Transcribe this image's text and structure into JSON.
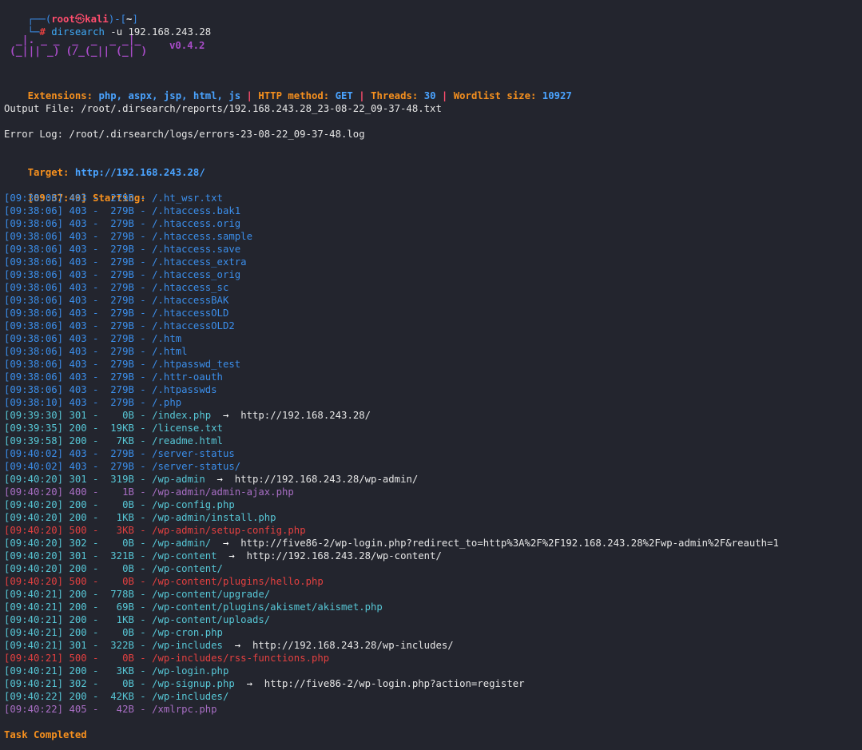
{
  "prompt": {
    "corner_top": "┌──(",
    "user": "root",
    "skull": "㉿",
    "host": "kali",
    "close": ")-[",
    "dir": "~",
    "close2": "]",
    "corner_bottom": "└─",
    "hash": "#",
    "command": "dirsearch",
    "args": " -u 192.168.243.28"
  },
  "banner": {
    "art_line1": " _|. _ _  _  _  _ _|_",
    "art_line2": "(_||| _) (/_(_|| (_| )",
    "version": "v0.4.2"
  },
  "config": {
    "ext_label": "Extensions: ",
    "ext_value": "php, aspx, jsp, html, js",
    "sep": " | ",
    "method_label": "HTTP method: ",
    "method_value": "GET",
    "threads_label": "Threads: ",
    "threads_value": "30",
    "wordlist_label": "Wordlist size: ",
    "wordlist_value": "10927"
  },
  "output_file": "Output File: /root/.dirsearch/reports/192.168.243.28_23-08-22_09-37-48.txt",
  "error_log": "Error Log: /root/.dirsearch/logs/errors-23-08-22_09-37-48.log",
  "target_label": "Target: ",
  "target_url": "http://192.168.243.28/",
  "start_time": "[09:37:49]",
  "start_label": " Starting:",
  "results": [
    {
      "t": "[09:38:06]",
      "code": "403",
      "size": "279B",
      "path": "/.ht_wsr.txt",
      "redirect": ""
    },
    {
      "t": "[09:38:06]",
      "code": "403",
      "size": "279B",
      "path": "/.htaccess.bak1",
      "redirect": ""
    },
    {
      "t": "[09:38:06]",
      "code": "403",
      "size": "279B",
      "path": "/.htaccess.orig",
      "redirect": ""
    },
    {
      "t": "[09:38:06]",
      "code": "403",
      "size": "279B",
      "path": "/.htaccess.sample",
      "redirect": ""
    },
    {
      "t": "[09:38:06]",
      "code": "403",
      "size": "279B",
      "path": "/.htaccess.save",
      "redirect": ""
    },
    {
      "t": "[09:38:06]",
      "code": "403",
      "size": "279B",
      "path": "/.htaccess_extra",
      "redirect": ""
    },
    {
      "t": "[09:38:06]",
      "code": "403",
      "size": "279B",
      "path": "/.htaccess_orig",
      "redirect": ""
    },
    {
      "t": "[09:38:06]",
      "code": "403",
      "size": "279B",
      "path": "/.htaccess_sc",
      "redirect": ""
    },
    {
      "t": "[09:38:06]",
      "code": "403",
      "size": "279B",
      "path": "/.htaccessBAK",
      "redirect": ""
    },
    {
      "t": "[09:38:06]",
      "code": "403",
      "size": "279B",
      "path": "/.htaccessOLD",
      "redirect": ""
    },
    {
      "t": "[09:38:06]",
      "code": "403",
      "size": "279B",
      "path": "/.htaccessOLD2",
      "redirect": ""
    },
    {
      "t": "[09:38:06]",
      "code": "403",
      "size": "279B",
      "path": "/.htm",
      "redirect": ""
    },
    {
      "t": "[09:38:06]",
      "code": "403",
      "size": "279B",
      "path": "/.html",
      "redirect": ""
    },
    {
      "t": "[09:38:06]",
      "code": "403",
      "size": "279B",
      "path": "/.htpasswd_test",
      "redirect": ""
    },
    {
      "t": "[09:38:06]",
      "code": "403",
      "size": "279B",
      "path": "/.httr-oauth",
      "redirect": ""
    },
    {
      "t": "[09:38:06]",
      "code": "403",
      "size": "279B",
      "path": "/.htpasswds",
      "redirect": ""
    },
    {
      "t": "[09:38:10]",
      "code": "403",
      "size": "279B",
      "path": "/.php",
      "redirect": ""
    },
    {
      "t": "[09:39:30]",
      "code": "301",
      "size": "0B",
      "path": "/index.php",
      "redirect": "http://192.168.243.28/"
    },
    {
      "t": "[09:39:35]",
      "code": "200",
      "size": "19KB",
      "path": "/license.txt",
      "redirect": ""
    },
    {
      "t": "[09:39:58]",
      "code": "200",
      "size": "7KB",
      "path": "/readme.html",
      "redirect": ""
    },
    {
      "t": "[09:40:02]",
      "code": "403",
      "size": "279B",
      "path": "/server-status",
      "redirect": ""
    },
    {
      "t": "[09:40:02]",
      "code": "403",
      "size": "279B",
      "path": "/server-status/",
      "redirect": ""
    },
    {
      "t": "[09:40:20]",
      "code": "301",
      "size": "319B",
      "path": "/wp-admin",
      "redirect": "http://192.168.243.28/wp-admin/"
    },
    {
      "t": "[09:40:20]",
      "code": "400",
      "size": "1B",
      "path": "/wp-admin/admin-ajax.php",
      "redirect": ""
    },
    {
      "t": "[09:40:20]",
      "code": "200",
      "size": "0B",
      "path": "/wp-config.php",
      "redirect": ""
    },
    {
      "t": "[09:40:20]",
      "code": "200",
      "size": "1KB",
      "path": "/wp-admin/install.php",
      "redirect": ""
    },
    {
      "t": "[09:40:20]",
      "code": "500",
      "size": "3KB",
      "path": "/wp-admin/setup-config.php",
      "redirect": ""
    },
    {
      "t": "[09:40:20]",
      "code": "302",
      "size": "0B",
      "path": "/wp-admin/",
      "redirect": "http://five86-2/wp-login.php?redirect_to=http%3A%2F%2F192.168.243.28%2Fwp-admin%2F&reauth=1"
    },
    {
      "t": "[09:40:20]",
      "code": "301",
      "size": "321B",
      "path": "/wp-content",
      "redirect": "http://192.168.243.28/wp-content/"
    },
    {
      "t": "[09:40:20]",
      "code": "200",
      "size": "0B",
      "path": "/wp-content/",
      "redirect": ""
    },
    {
      "t": "[09:40:20]",
      "code": "500",
      "size": "0B",
      "path": "/wp-content/plugins/hello.php",
      "redirect": ""
    },
    {
      "t": "[09:40:21]",
      "code": "200",
      "size": "778B",
      "path": "/wp-content/upgrade/",
      "redirect": ""
    },
    {
      "t": "[09:40:21]",
      "code": "200",
      "size": "69B",
      "path": "/wp-content/plugins/akismet/akismet.php",
      "redirect": ""
    },
    {
      "t": "[09:40:21]",
      "code": "200",
      "size": "1KB",
      "path": "/wp-content/uploads/",
      "redirect": ""
    },
    {
      "t": "[09:40:21]",
      "code": "200",
      "size": "0B",
      "path": "/wp-cron.php",
      "redirect": ""
    },
    {
      "t": "[09:40:21]",
      "code": "301",
      "size": "322B",
      "path": "/wp-includes",
      "redirect": "http://192.168.243.28/wp-includes/"
    },
    {
      "t": "[09:40:21]",
      "code": "500",
      "size": "0B",
      "path": "/wp-includes/rss-functions.php",
      "redirect": ""
    },
    {
      "t": "[09:40:21]",
      "code": "200",
      "size": "3KB",
      "path": "/wp-login.php",
      "redirect": ""
    },
    {
      "t": "[09:40:21]",
      "code": "302",
      "size": "0B",
      "path": "/wp-signup.php",
      "redirect": "http://five86-2/wp-login.php?action=register"
    },
    {
      "t": "[09:40:22]",
      "code": "200",
      "size": "42KB",
      "path": "/wp-includes/",
      "redirect": ""
    },
    {
      "t": "[09:40:22]",
      "code": "405",
      "size": "42B",
      "path": "/xmlrpc.php",
      "redirect": ""
    }
  ],
  "arrow": "→",
  "task_completed": "Task Completed",
  "colors": {
    "background": "#23252e",
    "code_403": "#3b8eea",
    "code_2xx_3xx": "#57c7d6",
    "code_400_405": "#a86ec4",
    "code_500": "#e34040",
    "accent_orange": "#f6901e",
    "accent_purple": "#a84cc8"
  }
}
